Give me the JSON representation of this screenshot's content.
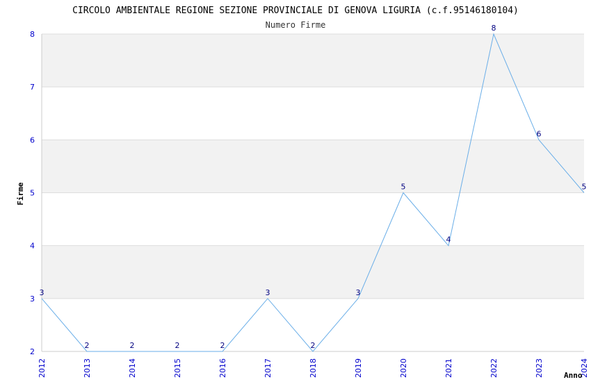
{
  "chart_data": {
    "type": "line",
    "title": "CIRCOLO AMBIENTALE REGIONE SEZIONE PROVINCIALE DI GENOVA LIGURIA (c.f.95146180104)",
    "subtitle": "Numero Firme",
    "xlabel": "Anno",
    "ylabel": "Firme",
    "x": [
      "2012",
      "2013",
      "2014",
      "2015",
      "2016",
      "2017",
      "2018",
      "2019",
      "2020",
      "2021",
      "2022",
      "2023",
      "2024"
    ],
    "series": [
      {
        "values": [
          3,
          2,
          2,
          2,
          2,
          3,
          2,
          3,
          5,
          4,
          8,
          6,
          5
        ]
      }
    ],
    "ylim": [
      2,
      8
    ],
    "yticks": [
      "2",
      "3",
      "4",
      "5",
      "6",
      "7",
      "8"
    ],
    "grid": true,
    "line_color": "#6aaee8",
    "band_color": "#f2f2f2",
    "tick_color": "#0000cc",
    "label_color": "#000080"
  }
}
